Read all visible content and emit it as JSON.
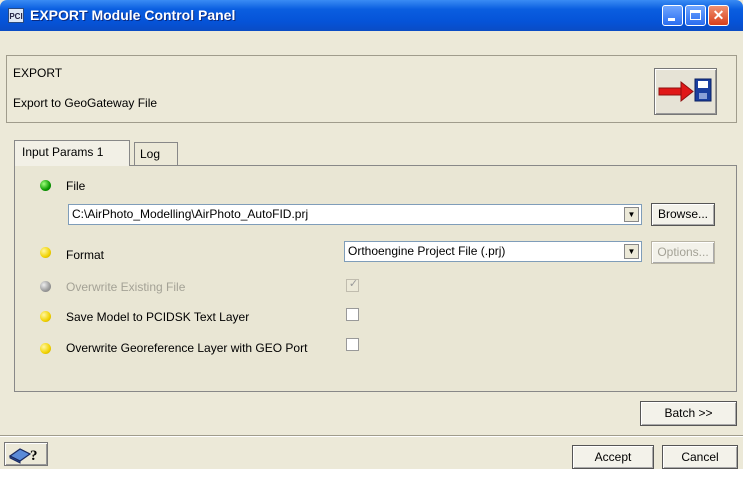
{
  "window": {
    "title": "EXPORT Module Control Panel",
    "app_icon_text": "PCI"
  },
  "header": {
    "module_name": "EXPORT",
    "module_description": "Export to GeoGateway File",
    "run_icon": "arrow-to-disk-icon"
  },
  "tabs": [
    {
      "label": "Input Params 1",
      "active": true
    },
    {
      "label": "Log",
      "active": false
    }
  ],
  "params": {
    "file": {
      "label": "File",
      "value": "C:\\AirPhoto_Modelling\\AirPhoto_AutoFID.prj",
      "browse_label": "Browse...",
      "status": "green"
    },
    "format": {
      "label": "Format",
      "value": "Orthoengine Project File (.prj)",
      "options_label": "Options...",
      "status": "yellow"
    },
    "overwrite_existing": {
      "label": "Overwrite Existing File",
      "checked": true,
      "enabled": false,
      "status": "gray"
    },
    "save_model": {
      "label": "Save Model to PCIDSK Text Layer",
      "checked": false,
      "status": "yellow"
    },
    "overwrite_georef": {
      "label": "Overwrite Georeference Layer with GEO Port",
      "checked": false,
      "status": "yellow"
    }
  },
  "footer": {
    "batch_label": "Batch >>",
    "accept_label": "Accept",
    "cancel_label": "Cancel",
    "help_icon": "help-book-icon",
    "help_text": "?"
  },
  "colors": {
    "titlebar": "#0553d8",
    "window_bg": "#ece9d8",
    "close_btn": "#d8401c",
    "status_green": "#0a9a00",
    "status_yellow": "#f1d200",
    "status_gray": "#999999",
    "export_arrow": "#e01818",
    "disk": "#1a3fa0"
  }
}
